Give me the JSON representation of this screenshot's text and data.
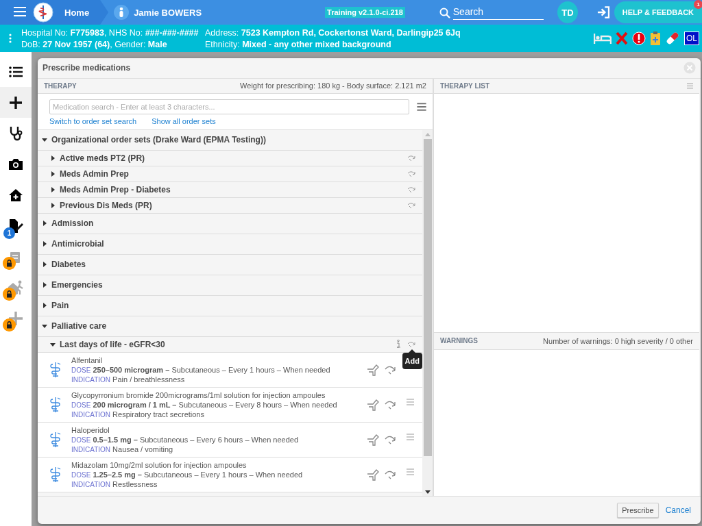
{
  "header": {
    "home": "Home",
    "patient_name": "Jamie BOWERS",
    "environment": "Training v2.1.0-ci.218",
    "search_placeholder": "Search",
    "user_initials": "TD",
    "help_button": "HELP & FEEDBACK",
    "help_badge": "1"
  },
  "patient_banner": {
    "hospital_line": "Hospital No: **F775983**, NHS No: **###-###-####**",
    "dob_line": "DoB: **27 Nov 1957 (64)**, Gender: **Male**",
    "address_line": "Address: **7523 Kempton Rd, Cockertonst Ward, Darlingip25 6Jq**",
    "ethnicity_line": "Ethnicity: **Mixed - any other mixed background**",
    "flag": "OL"
  },
  "sidebar": {
    "items": [
      {
        "selected": false,
        "locked": false
      },
      {
        "selected": true,
        "locked": false
      },
      {
        "selected": false,
        "locked": false
      },
      {
        "selected": false,
        "locked": false
      },
      {
        "selected": false,
        "locked": false
      },
      {
        "selected": false,
        "locked": false,
        "badge": "1"
      },
      {
        "selected": false,
        "locked": true
      },
      {
        "selected": false,
        "locked": true
      },
      {
        "selected": false,
        "locked": true
      }
    ]
  },
  "dialog": {
    "title": "Prescribe medications",
    "therapy": {
      "header": "THERAPY",
      "weight_info": "Weight for prescribing: 180 kg - Body surface: 2.121 m2",
      "search_placeholder": "Medication search - Enter at least 3 characters...",
      "links": [
        "Switch to order set search",
        "Show all order sets"
      ],
      "order_sets": [
        {
          "label": "Organizational order sets (Drake Ward (EPMA Testing))",
          "expanded": true,
          "children": [
            {
              "label": "Active meds PT2 (PR)",
              "expanded": false
            },
            {
              "label": "Meds Admin Prep",
              "expanded": false
            },
            {
              "label": "Meds Admin Prep - Diabetes",
              "expanded": false
            },
            {
              "label": "Previous Dis Meds (PR)",
              "expanded": false
            }
          ]
        },
        {
          "label": "Admission",
          "expanded": false
        },
        {
          "label": "Antimicrobial",
          "expanded": false
        },
        {
          "label": "Diabetes",
          "expanded": false
        },
        {
          "label": "Emergencies",
          "expanded": false
        },
        {
          "label": "Pain",
          "expanded": false
        },
        {
          "label": "Palliative care",
          "expanded": true,
          "children": [
            {
              "label": "Last days of life - eGFR<30",
              "expanded": true,
              "tooltip": "Add",
              "medications": [
                {
                  "name": "Alfentanil",
                  "dose_label": "DOSE",
                  "dose": "**250–500 microgram –** Subcutaneous – Every 1 hours – When needed",
                  "indication_label": "INDICATION",
                  "indication": "Pain / breathlessness",
                  "menu": false
                },
                {
                  "name": "Glycopyrronium bromide 200micrograms/1ml solution for injection ampoules",
                  "dose_label": "DOSE",
                  "dose": "**200 microgram / 1 mL –** Subcutaneous – Every 8 hours – When needed",
                  "indication_label": "INDICATION",
                  "indication": "Respiratory tract secretions",
                  "menu": true
                },
                {
                  "name": "Haloperidol",
                  "dose_label": "DOSE",
                  "dose": "**0.5–1.5 mg –** Subcutaneous – Every 6 hours – When needed",
                  "indication_label": "INDICATION",
                  "indication": "Nausea / vomiting",
                  "menu": true
                },
                {
                  "name": "Midazolam 10mg/2ml solution for injection ampoules",
                  "dose_label": "DOSE",
                  "dose": "**1.25–2.5 mg –** Subcutaneous – Every 1 hours – When needed",
                  "indication_label": "INDICATION",
                  "indication": "Restlessness",
                  "menu": true
                }
              ]
            }
          ]
        }
      ]
    },
    "therapy_list": {
      "header": "THERAPY LIST"
    },
    "warnings": {
      "header": "WARNINGS",
      "summary": "Number of warnings: 0 high severity / 0 other"
    },
    "buttons": [
      {
        "label": "Prescribe",
        "kind": "button"
      },
      {
        "label": "Cancel",
        "kind": "link"
      }
    ]
  }
}
